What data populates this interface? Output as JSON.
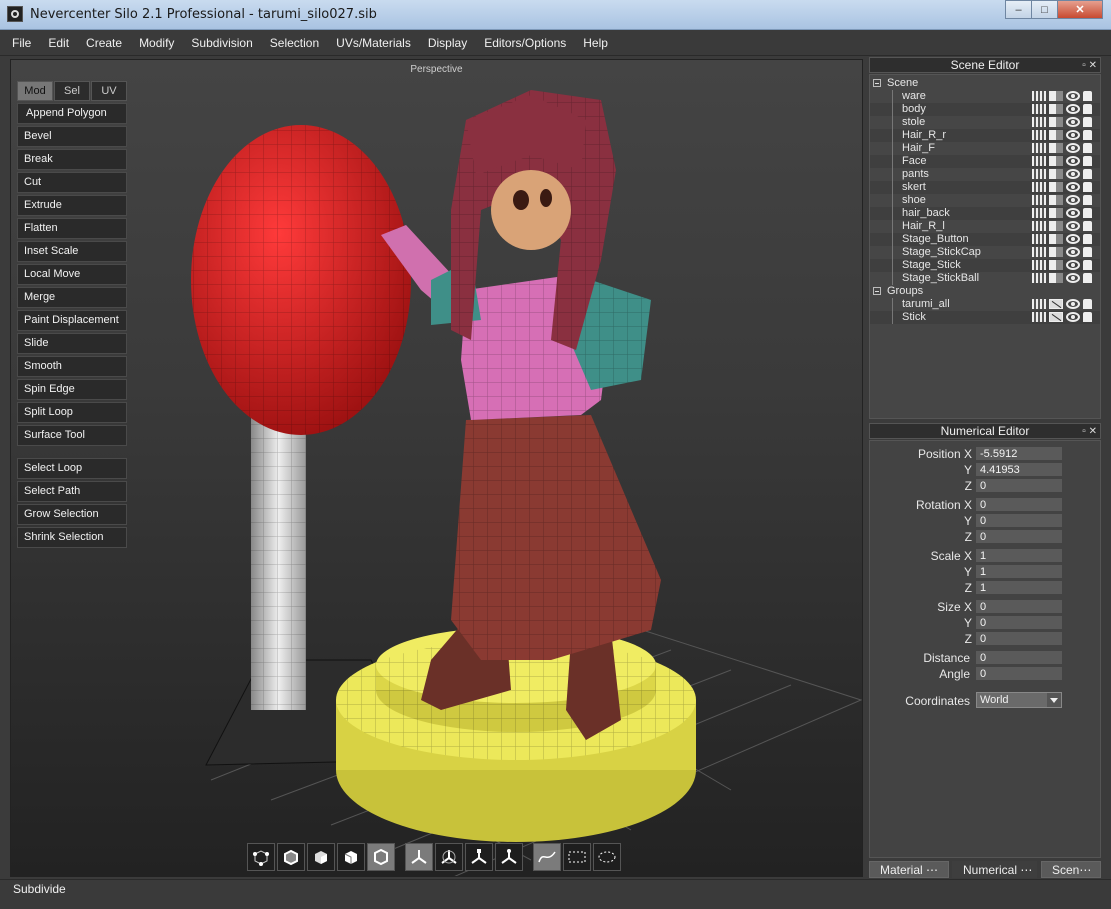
{
  "window": {
    "title": "Nevercenter Silo 2.1 Professional - tarumi_silo027.sib",
    "minimize": "–",
    "maximize": "□",
    "close": "✕"
  },
  "menu": [
    "File",
    "Edit",
    "Create",
    "Modify",
    "Subdivision",
    "Selection",
    "UVs/Materials",
    "Display",
    "Editors/Options",
    "Help"
  ],
  "viewport": {
    "label": "Perspective",
    "mode_tabs": [
      "Mod",
      "Sel",
      "UV"
    ],
    "active_mode": "Mod",
    "tools": [
      "Append Polygon",
      "Bevel",
      "Break",
      "Cut",
      "Extrude",
      "Flatten",
      "Inset Scale",
      "Local Move",
      "Merge",
      "Paint Displacement",
      "Slide",
      "Smooth",
      "Spin Edge",
      "Split Loop",
      "Surface Tool"
    ],
    "selection_tools": [
      "Select Loop",
      "Select Path",
      "Grow Selection",
      "Shrink Selection"
    ],
    "bottom_toolbar": {
      "selection_modes": [
        "vertex-mode-icon",
        "edge-mode-icon",
        "face-mode-icon",
        "object-mode-icon",
        "all-mode-icon"
      ],
      "manipulators": [
        "move-manipulator-icon",
        "rotate-manipulator-icon",
        "scale-manipulator-icon",
        "universal-manipulator-icon"
      ],
      "select_shapes": [
        "lasso-select-icon",
        "box-select-icon",
        "paint-select-icon"
      ]
    }
  },
  "scene_editor": {
    "title": "Scene Editor",
    "scene_label": "Scene",
    "objects": [
      "ware",
      "body",
      "stole",
      "Hair_R_r",
      "Hair_F",
      "Face",
      "pants",
      "skert",
      "shoe",
      "hair_back",
      "Hair_R_l",
      "Stage_Button",
      "Stage_StickCap",
      "Stage_Stick",
      "Stage_StickBall"
    ],
    "groups_label": "Groups",
    "groups": [
      "tarumi_all",
      "Stick"
    ]
  },
  "numerical_editor": {
    "title": "Numerical Editor",
    "position": {
      "label": "Position",
      "x": "-5.5912",
      "y": "4.41953",
      "z": "0"
    },
    "rotation": {
      "label": "Rotation",
      "x": "0",
      "y": "0",
      "z": "0"
    },
    "scale": {
      "label": "Scale",
      "x": "1",
      "y": "1",
      "z": "1"
    },
    "size": {
      "label": "Size",
      "x": "0",
      "y": "0",
      "z": "0"
    },
    "distance": {
      "label": "Distance",
      "value": "0"
    },
    "angle": {
      "label": "Angle",
      "value": "0"
    },
    "axis_labels": {
      "x": "X",
      "y": "Y",
      "z": "Z"
    },
    "coordinates": {
      "label": "Coordinates",
      "value": "World"
    }
  },
  "side_tabs": [
    "Material ⋯",
    "Numerical ⋯",
    "Scen⋯"
  ],
  "status": "Subdivide",
  "colors": {
    "sphere": "#e8262a",
    "stage": "#e6e04a",
    "shirt": "#d66fb5",
    "skirt": "#7a3a30",
    "hair": "#8a3040",
    "stole": "#3f8f88"
  }
}
